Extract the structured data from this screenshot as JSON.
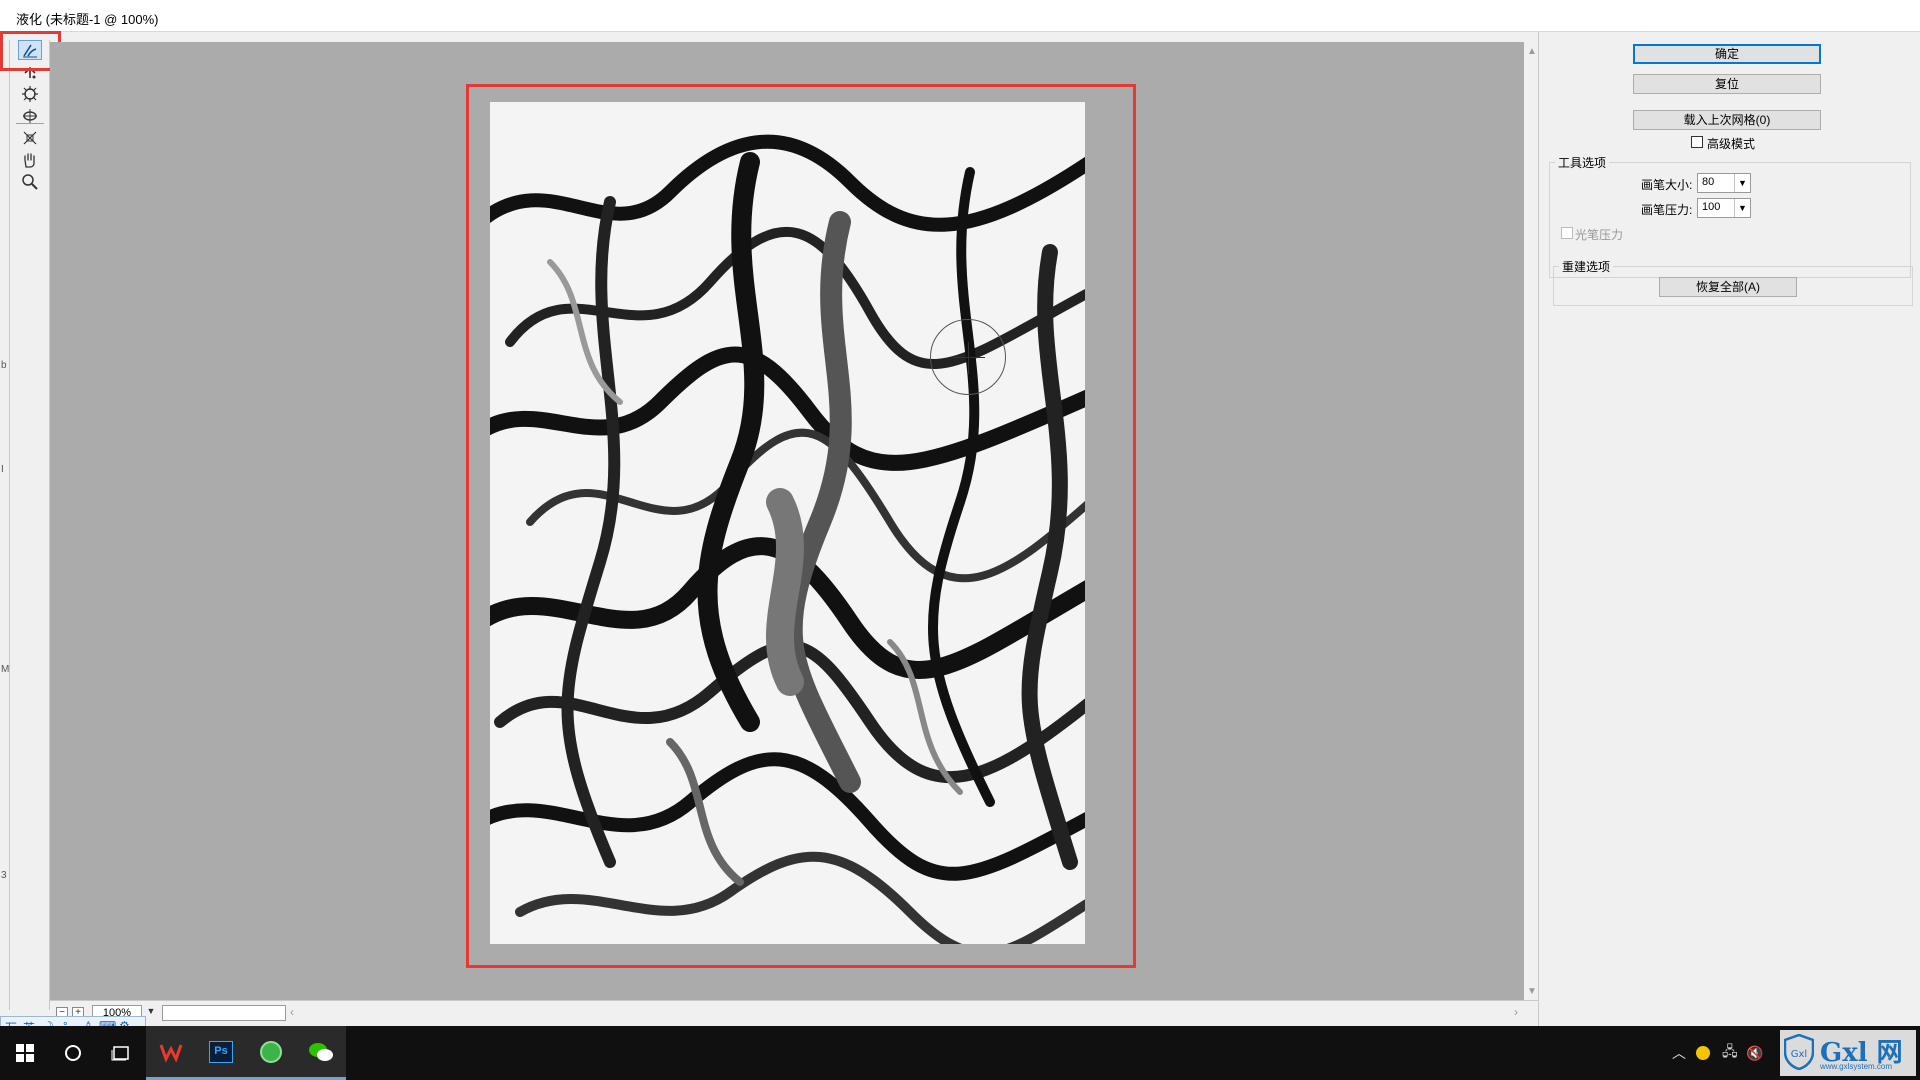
{
  "window": {
    "title": "液化 (未标题-1 @ 100%)"
  },
  "left_markers": [
    "b",
    "I",
    "M",
    "3"
  ],
  "tools": [
    {
      "name": "forward-warp-tool-icon",
      "active": true
    },
    {
      "name": "reconstruct-tool-icon",
      "active": false
    },
    {
      "name": "pucker-tool-icon",
      "active": false
    },
    {
      "name": "bloat-tool-icon",
      "active": false
    },
    {
      "name": "push-left-tool-icon",
      "active": false
    },
    {
      "name": "hand-tool-icon",
      "active": false
    },
    {
      "name": "zoom-tool-icon",
      "active": false
    }
  ],
  "panel": {
    "ok_label": "确定",
    "reset_label": "复位",
    "load_mesh_label": "载入上次网格(0)",
    "advanced_mode_label": "高级模式",
    "advanced_mode_checked": false,
    "tool_options_title": "工具选项",
    "brush_size_label": "画笔大小:",
    "brush_size_value": "80",
    "brush_pressure_label": "画笔压力:",
    "brush_pressure_value": "100",
    "stylus_pressure_label": "光笔压力",
    "reconstruct_title": "重建选项",
    "restore_all_label": "恢复全部(A)"
  },
  "bottom": {
    "zoom_value": "100%",
    "zoom_out": "−",
    "zoom_in": "+"
  },
  "ime": {
    "text": "英"
  },
  "taskbar": {
    "apps": [
      "start-icon",
      "search-icon",
      "task-view-icon",
      "wps-icon",
      "photoshop-icon",
      "browser-icon",
      "wechat-icon"
    ],
    "photoshop_label": "Ps"
  },
  "watermark": {
    "text": "Gxl 网",
    "url": "www.gxlsystem.com"
  },
  "colors": {
    "accent": "#0078d7",
    "highlight": "#e53935",
    "canvas_bg": "#ababab"
  }
}
